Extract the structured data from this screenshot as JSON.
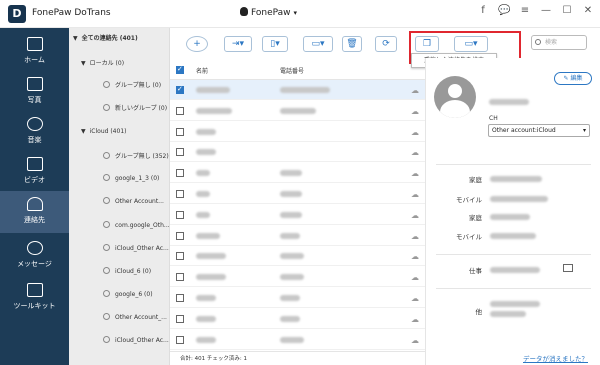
{
  "app": {
    "title": "FonePaw DoTrans",
    "logo": "D",
    "device": "FonePaw"
  },
  "window_controls": [
    "f",
    "💬",
    "≡",
    "—",
    "☐",
    "✕"
  ],
  "sidebar": {
    "items": [
      {
        "label": "ホーム",
        "icon": "home-icon"
      },
      {
        "label": "写真",
        "icon": "photo-icon"
      },
      {
        "label": "音楽",
        "icon": "music-icon"
      },
      {
        "label": "ビデオ",
        "icon": "video-icon"
      },
      {
        "label": "連絡先",
        "icon": "contacts-icon"
      },
      {
        "label": "メッセージ",
        "icon": "message-icon"
      },
      {
        "label": "ツールキット",
        "icon": "toolkit-icon"
      }
    ]
  },
  "groups": {
    "all": "全ての連絡先 (401)",
    "local": "ローカル (0)",
    "local_items": [
      "グループ無し (0)",
      "新しいグループ (0)"
    ],
    "icloud": "iCloud (401)",
    "icloud_items": [
      "グループ無し (352)",
      "google_1_3 (0)",
      "Other Account...",
      "com.google_Oth...",
      "iCloud_Other Ac...",
      "iCloud_6 (0)",
      "google_6 (0)",
      "Other Account_...",
      "iCloud_Other Ac..."
    ]
  },
  "toolbar": {
    "tooltip": "重複した連絡先を検索",
    "search_placeholder": "検索"
  },
  "list": {
    "col_name": "名前",
    "col_phone": "電話番号",
    "status": "合計: 401 チェック済み: 1",
    "row_count": 13,
    "checked_row": 0
  },
  "detail": {
    "edit_label": "編集",
    "account_label": "CH",
    "account": "Other account:iCloud",
    "field_labels": [
      "家庭",
      "モバイル",
      "家庭",
      "モバイル",
      "仕事",
      "他"
    ],
    "missing_link": "データが消えました？"
  }
}
